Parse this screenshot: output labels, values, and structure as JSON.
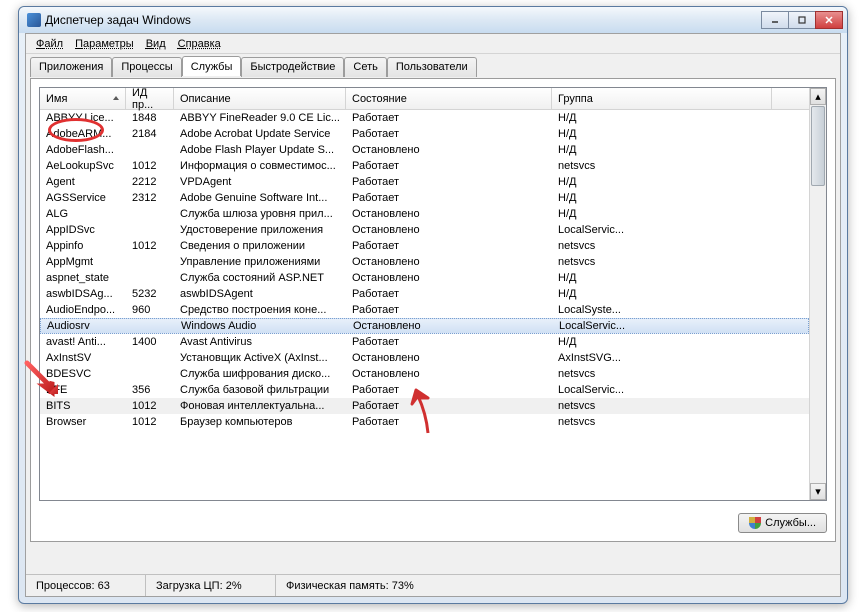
{
  "window": {
    "title": "Диспетчер задач Windows"
  },
  "menu": [
    "Файл",
    "Параметры",
    "Вид",
    "Справка"
  ],
  "tabs": [
    {
      "label": "Приложения",
      "active": false
    },
    {
      "label": "Процессы",
      "active": false
    },
    {
      "label": "Службы",
      "active": true
    },
    {
      "label": "Быстродействие",
      "active": false
    },
    {
      "label": "Сеть",
      "active": false
    },
    {
      "label": "Пользователи",
      "active": false
    }
  ],
  "columns": [
    {
      "label": "Имя",
      "sorted": true
    },
    {
      "label": "ИД пр..."
    },
    {
      "label": "Описание"
    },
    {
      "label": "Состояние"
    },
    {
      "label": "Группа"
    }
  ],
  "rows": [
    {
      "name": "ABBYY.Lice...",
      "pid": "1848",
      "desc": "ABBYY FineReader 9.0 CE Lic...",
      "state": "Работает",
      "group": "Н/Д"
    },
    {
      "name": "AdobeARM...",
      "pid": "2184",
      "desc": "Adobe Acrobat Update Service",
      "state": "Работает",
      "group": "Н/Д"
    },
    {
      "name": "AdobeFlash...",
      "pid": "",
      "desc": "Adobe Flash Player Update S...",
      "state": "Остановлено",
      "group": "Н/Д"
    },
    {
      "name": "AeLookupSvc",
      "pid": "1012",
      "desc": "Информация о совместимос...",
      "state": "Работает",
      "group": "netsvcs"
    },
    {
      "name": "Agent",
      "pid": "2212",
      "desc": "VPDAgent",
      "state": "Работает",
      "group": "Н/Д"
    },
    {
      "name": "AGSService",
      "pid": "2312",
      "desc": "Adobe Genuine Software Int...",
      "state": "Работает",
      "group": "Н/Д"
    },
    {
      "name": "ALG",
      "pid": "",
      "desc": "Служба шлюза уровня прил...",
      "state": "Остановлено",
      "group": "Н/Д"
    },
    {
      "name": "AppIDSvc",
      "pid": "",
      "desc": "Удостоверение приложения",
      "state": "Остановлено",
      "group": "LocalServic..."
    },
    {
      "name": "Appinfo",
      "pid": "1012",
      "desc": "Сведения о приложении",
      "state": "Работает",
      "group": "netsvcs"
    },
    {
      "name": "AppMgmt",
      "pid": "",
      "desc": "Управление приложениями",
      "state": "Остановлено",
      "group": "netsvcs"
    },
    {
      "name": "aspnet_state",
      "pid": "",
      "desc": "Служба состояний ASP.NET",
      "state": "Остановлено",
      "group": "Н/Д"
    },
    {
      "name": "aswbIDSAg...",
      "pid": "5232",
      "desc": "aswbIDSAgent",
      "state": "Работает",
      "group": "Н/Д"
    },
    {
      "name": "AudioEndpo...",
      "pid": "960",
      "desc": "Средство построения коне...",
      "state": "Работает",
      "group": "LocalSyste..."
    },
    {
      "name": "Audiosrv",
      "pid": "",
      "desc": "Windows Audio",
      "state": "Остановлено",
      "group": "LocalServic...",
      "selected": true
    },
    {
      "name": "avast! Anti...",
      "pid": "1400",
      "desc": "Avast Antivirus",
      "state": "Работает",
      "group": "Н/Д"
    },
    {
      "name": "AxInstSV",
      "pid": "",
      "desc": "Установщик ActiveX (AxInst...",
      "state": "Остановлено",
      "group": "AxInstSVG..."
    },
    {
      "name": "BDESVC",
      "pid": "",
      "desc": "Служба шифрования диско...",
      "state": "Остановлено",
      "group": "netsvcs"
    },
    {
      "name": "BFE",
      "pid": "356",
      "desc": "Служба базовой фильтрации",
      "state": "Работает",
      "group": "LocalServic..."
    },
    {
      "name": "BITS",
      "pid": "1012",
      "desc": "Фоновая интеллектуальна...",
      "state": "Работает",
      "group": "netsvcs",
      "bits": true
    },
    {
      "name": "Browser",
      "pid": "1012",
      "desc": "Браузер компьютеров",
      "state": "Работает",
      "group": "netsvcs"
    }
  ],
  "services_button": "Службы...",
  "status": {
    "processes": "Процессов: 63",
    "cpu": "Загрузка ЦП: 2%",
    "memory": "Физическая память: 73%"
  }
}
